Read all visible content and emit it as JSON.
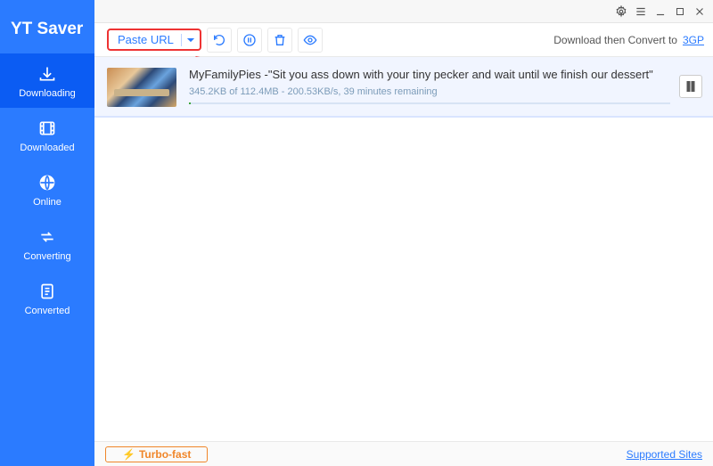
{
  "app": {
    "title": "YT Saver"
  },
  "sidebar": {
    "items": [
      {
        "label": "Downloading"
      },
      {
        "label": "Downloaded"
      },
      {
        "label": "Online"
      },
      {
        "label": "Converting"
      },
      {
        "label": "Converted"
      }
    ]
  },
  "toolbar": {
    "paste_label": "Paste URL",
    "convert_label": "Download then Convert to",
    "convert_format": "3GP"
  },
  "download": {
    "title": "MyFamilyPies -\"Sit you ass down with your tiny pecker and wait until we finish our dessert\"",
    "stats": "345.2KB of 112.4MB - 200.53KB/s, 39 minutes remaining"
  },
  "footer": {
    "turbo_label": "Turbo-fast",
    "supported_label": "Supported Sites"
  }
}
